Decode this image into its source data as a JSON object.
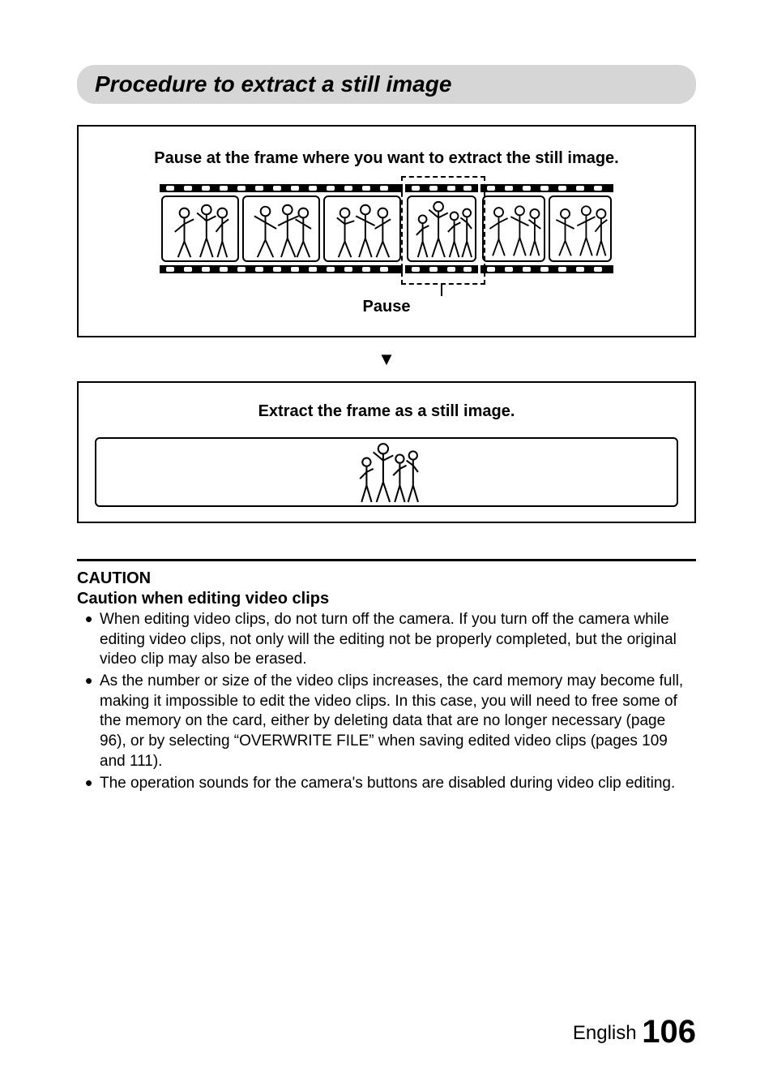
{
  "heading": "Procedure to extract a still image",
  "step1": {
    "title": "Pause at the frame where you want to extract the still image.",
    "pause_label": "Pause"
  },
  "arrow": "▼",
  "step2": {
    "title": "Extract the frame as a still image."
  },
  "caution": {
    "head": "CAUTION",
    "sub": "Caution when editing video clips",
    "items": [
      "When editing video clips, do not turn off the camera. If you turn off the camera while editing video clips, not only will the editing not be properly completed, but the original video clip may also be erased.",
      "As the number or size of the video clips increases, the card memory may become full, making it impossible to edit the video clips. In this case, you will need to free some of the memory on the card, either by deleting data that are no longer necessary (page 96), or by selecting “OVERWRITE FILE” when saving edited video clips (pages 109 and 111).",
      "The operation sounds for the camera's buttons are disabled during video clip editing."
    ]
  },
  "footer": {
    "lang": "English",
    "page": "106"
  }
}
